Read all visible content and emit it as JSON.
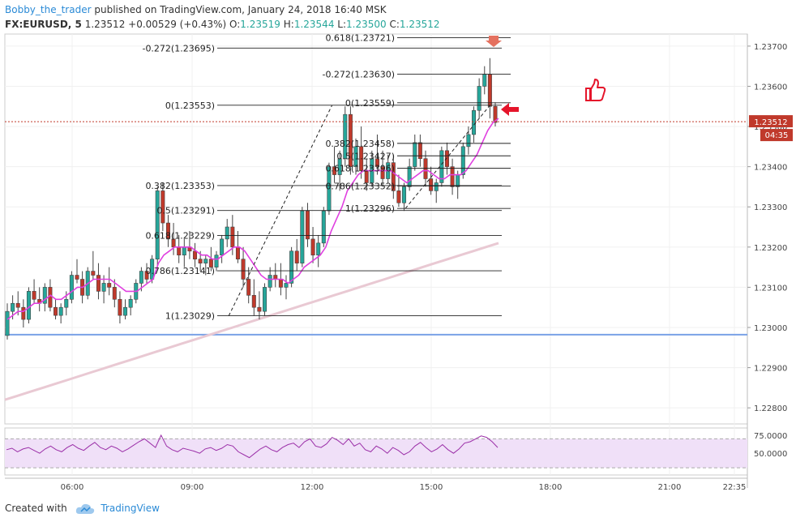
{
  "header": {
    "author": "Bobby_the_trader",
    "published": "published on TradingView.com, January 24, 2018 16:40 MSK",
    "symbol": "FX:EURUSD, 5",
    "last": "1.23512",
    "change": "+0.00529 (+0.43%)",
    "o_label": "O:",
    "o": "1.23519",
    "h_label": "H:",
    "h": "1.23544",
    "l_label": "L:",
    "l": "1.23500",
    "c_label": "C:",
    "c": "1.23512"
  },
  "footer": {
    "created": "Created with",
    "brand": "TradingView"
  },
  "colors": {
    "up": "#26a69a",
    "down": "#c0392b",
    "candle_border": "#444444",
    "ma_fast": "#e040e0",
    "ma_slow": "#e9c9d3",
    "support": "#7aa2e6",
    "price_line": "#c0392b",
    "rsi": "#9b2fa8",
    "rsi_band": "#f0e0f8",
    "arrow": "#e5152b"
  },
  "chart_data": [
    {
      "type": "candlestick",
      "y_ticks": [
        "1.23700",
        "1.23600",
        "1.23500",
        "1.23400",
        "1.23300",
        "1.23200",
        "1.23100",
        "1.23000",
        "1.22900",
        "1.22800"
      ],
      "ylim": [
        1.2276,
        1.2373
      ],
      "x_ticks": [
        "06:00",
        "09:00",
        "12:00",
        "15:00",
        "18:00",
        "21:00",
        "22:35"
      ],
      "last_price_label": "1.23512",
      "countdown_label": "04:35",
      "horizontal_level": 1.22982,
      "fib_left": {
        "levels": [
          {
            "label": "-0.272(1.23695)",
            "price": 1.23695
          },
          {
            "label": "0(1.23553)",
            "price": 1.23553
          },
          {
            "label": "0.382(1.23353)",
            "price": 1.23353
          },
          {
            "label": "0.5(1.23291)",
            "price": 1.23291
          },
          {
            "label": "0.618(1.23229)",
            "price": 1.23229
          },
          {
            "label": "0.786(1.23141)",
            "price": 1.23141
          },
          {
            "label": "1(1.23029)",
            "price": 1.23029
          }
        ]
      },
      "fib_right": {
        "levels": [
          {
            "label": "0.618(1.23721)",
            "price": 1.23721
          },
          {
            "label": "-0.272(1.23630)",
            "price": 1.2363
          },
          {
            "label": "0(1.23559)",
            "price": 1.23559
          },
          {
            "label": "0.382(1.23458)",
            "price": 1.23458
          },
          {
            "label": "0.5(1.23427)",
            "price": 1.23427
          },
          {
            "label": "0.618(1.23396)",
            "price": 1.23396
          },
          {
            "label": "0.786(1.23352)",
            "price": 1.23352
          },
          {
            "label": "1(1.23296)",
            "price": 1.23296
          }
        ]
      },
      "trendline_1": {
        "from": [
          "09:55",
          1.23029
        ],
        "to": [
          "12:30",
          1.23553
        ]
      },
      "trendline_2": {
        "from": [
          "14:20",
          1.23296
        ],
        "to": [
          "16:30",
          1.23559
        ]
      },
      "candles_ohlc": [
        [
          1.2298,
          1.2306,
          1.2297,
          1.2304
        ],
        [
          1.2304,
          1.2308,
          1.2302,
          1.2306
        ],
        [
          1.2306,
          1.2309,
          1.2303,
          1.2305
        ],
        [
          1.2305,
          1.2307,
          1.23,
          1.2302
        ],
        [
          1.2302,
          1.231,
          1.2301,
          1.2309
        ],
        [
          1.2309,
          1.2312,
          1.2306,
          1.2307
        ],
        [
          1.2307,
          1.231,
          1.2304,
          1.2306
        ],
        [
          1.2306,
          1.2311,
          1.2304,
          1.231
        ],
        [
          1.231,
          1.2312,
          1.2304,
          1.2305
        ],
        [
          1.2305,
          1.2307,
          1.2302,
          1.2303
        ],
        [
          1.2303,
          1.2306,
          1.2301,
          1.2305
        ],
        [
          1.2305,
          1.2309,
          1.2303,
          1.2307
        ],
        [
          1.2307,
          1.2314,
          1.2306,
          1.2313
        ],
        [
          1.2313,
          1.2317,
          1.2311,
          1.2312
        ],
        [
          1.2312,
          1.2314,
          1.2306,
          1.2308
        ],
        [
          1.2308,
          1.2315,
          1.2307,
          1.2314
        ],
        [
          1.2314,
          1.2319,
          1.2312,
          1.2313
        ],
        [
          1.2313,
          1.2316,
          1.2307,
          1.2309
        ],
        [
          1.2309,
          1.2313,
          1.2306,
          1.2311
        ],
        [
          1.2311,
          1.2315,
          1.2308,
          1.231
        ],
        [
          1.231,
          1.2312,
          1.2305,
          1.2307
        ],
        [
          1.2307,
          1.2309,
          1.2301,
          1.2303
        ],
        [
          1.2303,
          1.2307,
          1.2302,
          1.2305
        ],
        [
          1.2305,
          1.2308,
          1.2303,
          1.2307
        ],
        [
          1.2307,
          1.2312,
          1.2306,
          1.2311
        ],
        [
          1.2311,
          1.2315,
          1.2309,
          1.2314
        ],
        [
          1.2314,
          1.2316,
          1.2311,
          1.2312
        ],
        [
          1.2312,
          1.2318,
          1.2311,
          1.2317
        ],
        [
          1.2317,
          1.2335,
          1.2315,
          1.2334
        ],
        [
          1.2334,
          1.2336,
          1.2324,
          1.2326
        ],
        [
          1.2326,
          1.2328,
          1.232,
          1.2322
        ],
        [
          1.2322,
          1.2326,
          1.2318,
          1.232
        ],
        [
          1.232,
          1.2323,
          1.2316,
          1.2318
        ],
        [
          1.2318,
          1.2322,
          1.2315,
          1.232
        ],
        [
          1.232,
          1.2324,
          1.2317,
          1.2319
        ],
        [
          1.2319,
          1.2321,
          1.2315,
          1.2317
        ],
        [
          1.2317,
          1.2319,
          1.2314,
          1.2316
        ],
        [
          1.2316,
          1.2318,
          1.2313,
          1.2317
        ],
        [
          1.2317,
          1.232,
          1.2314,
          1.2315
        ],
        [
          1.2315,
          1.2319,
          1.2314,
          1.2318
        ],
        [
          1.2318,
          1.2323,
          1.2316,
          1.2322
        ],
        [
          1.2322,
          1.2327,
          1.232,
          1.2325
        ],
        [
          1.2325,
          1.2328,
          1.2318,
          1.232
        ],
        [
          1.232,
          1.2324,
          1.2316,
          1.2317
        ],
        [
          1.2317,
          1.232,
          1.231,
          1.2312
        ],
        [
          1.2312,
          1.2315,
          1.2306,
          1.2308
        ],
        [
          1.2308,
          1.2312,
          1.2303,
          1.2305
        ],
        [
          1.2305,
          1.2309,
          1.2302,
          1.2304
        ],
        [
          1.2304,
          1.2311,
          1.2303,
          1.231
        ],
        [
          1.231,
          1.2315,
          1.2309,
          1.2313
        ],
        [
          1.2313,
          1.2316,
          1.231,
          1.2312
        ],
        [
          1.2312,
          1.2316,
          1.2308,
          1.231
        ],
        [
          1.231,
          1.2313,
          1.2307,
          1.2311
        ],
        [
          1.2311,
          1.232,
          1.231,
          1.2319
        ],
        [
          1.2319,
          1.2322,
          1.2314,
          1.2316
        ],
        [
          1.2316,
          1.233,
          1.2315,
          1.2329
        ],
        [
          1.2329,
          1.2331,
          1.232,
          1.2322
        ],
        [
          1.2322,
          1.2325,
          1.2316,
          1.2318
        ],
        [
          1.2318,
          1.2323,
          1.2315,
          1.2321
        ],
        [
          1.2321,
          1.233,
          1.232,
          1.2329
        ],
        [
          1.2329,
          1.2341,
          1.2328,
          1.234
        ],
        [
          1.234,
          1.2345,
          1.2336,
          1.2338
        ],
        [
          1.2338,
          1.2344,
          1.2334,
          1.2342
        ],
        [
          1.2342,
          1.2355,
          1.234,
          1.2353
        ],
        [
          1.2353,
          1.2355,
          1.2338,
          1.234
        ],
        [
          1.234,
          1.2347,
          1.2338,
          1.2345
        ],
        [
          1.2345,
          1.235,
          1.2337,
          1.2339
        ],
        [
          1.2339,
          1.2342,
          1.2334,
          1.2336
        ],
        [
          1.2336,
          1.2344,
          1.2335,
          1.2342
        ],
        [
          1.2342,
          1.2348,
          1.2338,
          1.234
        ],
        [
          1.234,
          1.2344,
          1.2335,
          1.2337
        ],
        [
          1.2337,
          1.2343,
          1.2336,
          1.2341
        ],
        [
          1.2341,
          1.2343,
          1.2332,
          1.2334
        ],
        [
          1.2334,
          1.2338,
          1.233,
          1.2331
        ],
        [
          1.2331,
          1.2336,
          1.2329,
          1.2335
        ],
        [
          1.2335,
          1.2342,
          1.2334,
          1.234
        ],
        [
          1.234,
          1.2348,
          1.2339,
          1.2346
        ],
        [
          1.2346,
          1.2348,
          1.234,
          1.2342
        ],
        [
          1.2342,
          1.2344,
          1.2335,
          1.2337
        ],
        [
          1.2337,
          1.234,
          1.2333,
          1.2334
        ],
        [
          1.2334,
          1.2337,
          1.2331,
          1.2336
        ],
        [
          1.2336,
          1.2345,
          1.2335,
          1.2344
        ],
        [
          1.2344,
          1.2346,
          1.2338,
          1.234
        ],
        [
          1.234,
          1.2342,
          1.2333,
          1.2335
        ],
        [
          1.2335,
          1.2339,
          1.2332,
          1.2338
        ],
        [
          1.2338,
          1.2346,
          1.2337,
          1.2345
        ],
        [
          1.2345,
          1.235,
          1.2343,
          1.2348
        ],
        [
          1.2348,
          1.2355,
          1.2346,
          1.2354
        ],
        [
          1.2354,
          1.2362,
          1.2352,
          1.236
        ],
        [
          1.236,
          1.2365,
          1.2358,
          1.2363
        ],
        [
          1.2363,
          1.2367,
          1.2352,
          1.2355
        ],
        [
          1.2355,
          1.2356,
          1.235,
          1.2351
        ]
      ],
      "ma_fast_values": [
        1.2302,
        1.2303,
        1.2304,
        1.2304,
        1.2305,
        1.2306,
        1.2306,
        1.2307,
        1.2308,
        1.2307,
        1.2307,
        1.2308,
        1.2309,
        1.231,
        1.231,
        1.2311,
        1.2312,
        1.2312,
        1.2312,
        1.2312,
        1.2311,
        1.231,
        1.2309,
        1.2309,
        1.2309,
        1.231,
        1.2311,
        1.2312,
        1.2316,
        1.2318,
        1.2319,
        1.232,
        1.232,
        1.232,
        1.232,
        1.2319,
        1.2318,
        1.2318,
        1.2317,
        1.2317,
        1.2318,
        1.2319,
        1.232,
        1.232,
        1.2319,
        1.2317,
        1.2315,
        1.2313,
        1.2312,
        1.2312,
        1.2312,
        1.2312,
        1.2311,
        1.2312,
        1.2313,
        1.2315,
        1.2316,
        1.2317,
        1.2318,
        1.232,
        1.2324,
        1.2327,
        1.233,
        1.2334,
        1.2336,
        1.2338,
        1.2339,
        1.2339,
        1.2339,
        1.2339,
        1.2339,
        1.2339,
        1.2338,
        1.2337,
        1.2336,
        1.2337,
        1.2338,
        1.2339,
        1.2339,
        1.2338,
        1.2337,
        1.2337,
        1.2338,
        1.2338,
        1.2338,
        1.2339,
        1.2341,
        1.2343,
        1.2346,
        1.2349,
        1.2351,
        1.2352
      ],
      "ma_slow_values": [
        1.2282,
        1.2283,
        1.2284,
        1.2285,
        1.2286,
        1.2287,
        1.2288,
        1.2289,
        1.229,
        1.2291,
        1.2292,
        1.2293,
        1.2294,
        1.2295,
        1.2296,
        1.2297,
        1.2298,
        1.2299,
        1.23,
        1.2301,
        1.2302,
        1.2303,
        1.2304,
        1.2305,
        1.2306,
        1.2307,
        1.2308,
        1.2309,
        1.231,
        1.2311,
        1.2312,
        1.2313,
        1.2314,
        1.2315,
        1.2316,
        1.2317,
        1.2318,
        1.2319,
        1.232,
        1.2321
      ],
      "rsi": {
        "levels": [
          "75.0000",
          "50.0000"
        ],
        "upper": 70,
        "lower": 30,
        "values": [
          55,
          57,
          52,
          56,
          58,
          54,
          50,
          56,
          60,
          55,
          52,
          58,
          62,
          57,
          54,
          60,
          65,
          58,
          55,
          60,
          57,
          52,
          56,
          61,
          66,
          70,
          64,
          58,
          75,
          60,
          55,
          52,
          57,
          55,
          53,
          50,
          56,
          58,
          54,
          57,
          62,
          60,
          52,
          48,
          44,
          50,
          56,
          60,
          55,
          52,
          58,
          62,
          64,
          58,
          66,
          70,
          60,
          58,
          63,
          72,
          68,
          62,
          70,
          60,
          64,
          55,
          52,
          60,
          56,
          50,
          58,
          54,
          48,
          52,
          60,
          65,
          58,
          52,
          56,
          62,
          55,
          50,
          56,
          64,
          66,
          70,
          74,
          72,
          66,
          58
        ]
      }
    }
  ]
}
